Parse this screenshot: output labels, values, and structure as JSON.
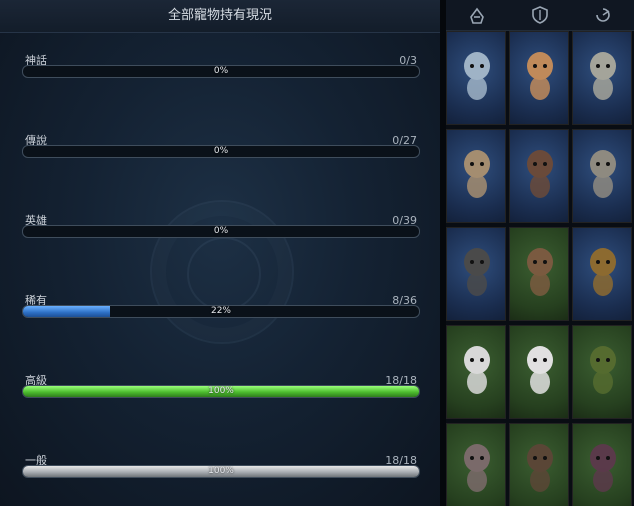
{
  "title": "全部寵物持有現況",
  "rows": [
    {
      "name": "神話",
      "count": "0/3",
      "percent_label": "0%",
      "progress": 0,
      "style": "blue"
    },
    {
      "name": "傳說",
      "count": "0/27",
      "percent_label": "0%",
      "progress": 0,
      "style": "blue"
    },
    {
      "name": "英雄",
      "count": "0/39",
      "percent_label": "0%",
      "progress": 0,
      "style": "blue"
    },
    {
      "name": "稀有",
      "count": "8/36",
      "percent_label": "22%",
      "progress": 0.22,
      "style": "blue"
    },
    {
      "name": "高級",
      "count": "18/18",
      "percent_label": "100%",
      "progress": 1.0,
      "style": "green"
    },
    {
      "name": "一般",
      "count": "18/18",
      "percent_label": "100%",
      "progress": 1.0,
      "style": "gray"
    }
  ],
  "tabs": [
    {
      "icon": "helmet-icon"
    },
    {
      "icon": "shield-icon"
    },
    {
      "icon": "swirl-icon"
    }
  ],
  "pets": [
    {
      "icon": "ice-dragon-pet-icon",
      "tier": "blue",
      "color": "#9fb3c6"
    },
    {
      "icon": "dwarf-warrior-pet-icon",
      "tier": "blue",
      "color": "#c08a5a"
    },
    {
      "icon": "viking-pet-icon",
      "tier": "blue",
      "color": "#a4a49a"
    },
    {
      "icon": "bear-pet-icon",
      "tier": "blue",
      "color": "#a48d70"
    },
    {
      "icon": "dark-knight-pet-icon",
      "tier": "blue",
      "color": "#6a4a3a"
    },
    {
      "icon": "stone-golem-pet-icon",
      "tier": "blue",
      "color": "#8e8a80"
    },
    {
      "icon": "boar-knight-pet-icon",
      "tier": "blue",
      "color": "#4a4a4a"
    },
    {
      "icon": "bearded-warrior-pet-icon",
      "tier": "green",
      "color": "#7a5a40"
    },
    {
      "icon": "beetle-pet-icon",
      "tier": "blue",
      "color": "#8c6a30"
    },
    {
      "icon": "white-bear-pet-icon",
      "tier": "green",
      "color": "#d8d8d8"
    },
    {
      "icon": "white-haired-pet-icon",
      "tier": "green",
      "color": "#e0e0e0"
    },
    {
      "icon": "goblin-pet-icon",
      "tier": "green",
      "color": "#556b2f"
    },
    {
      "icon": "bat-pet-icon",
      "tier": "green",
      "color": "#7a6a6a"
    },
    {
      "icon": "hooded-rogue-pet-icon",
      "tier": "green",
      "color": "#5a4636"
    },
    {
      "icon": "masked-pet-icon",
      "tier": "green",
      "color": "#5a3a4a"
    }
  ]
}
